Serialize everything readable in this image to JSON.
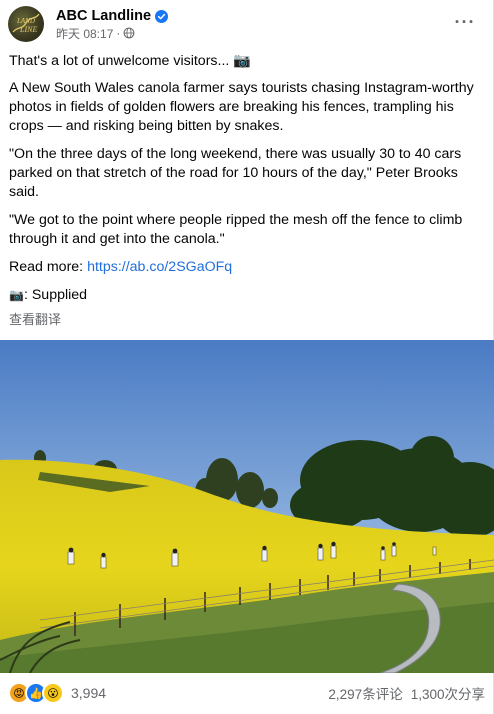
{
  "header": {
    "page_name": "ABC Landline",
    "timestamp": "昨天 08:17",
    "separator": "·",
    "more_label": "···"
  },
  "post": {
    "line1": "That's a lot of unwelcome visitors... 📷",
    "para1": "A New South Wales canola farmer says tourists chasing Instagram-worthy photos in fields of golden flowers are breaking his fences, trampling his crops — and risking being bitten by snakes.",
    "para2": "\"On the three days of the long weekend, there was usually 30 to 40 cars parked on that stretch of the road for 10 hours of the day,\" Peter Brooks said.",
    "para3": "\"We got to the point where people ripped the mesh off the fence to climb through it and get into the canola.\"",
    "read_more_label": "Read more: ",
    "read_more_url": "https://ab.co/2SGaOFq",
    "credit_icon": "📷",
    "credit_text": ": Supplied",
    "translate_label": "查看翻译"
  },
  "footer": {
    "reaction_count": "3,994",
    "comments": "2,297条评论",
    "shares": "1,300次分享"
  },
  "colors": {
    "link": "#216fdb",
    "verified": "#1877f2",
    "meta": "#65676b",
    "canola": "#e8d21a"
  },
  "icons": [
    "avatar-logo",
    "verified-icon",
    "globe-icon",
    "more-icon",
    "angry-react-icon",
    "like-react-icon",
    "wow-react-icon"
  ]
}
